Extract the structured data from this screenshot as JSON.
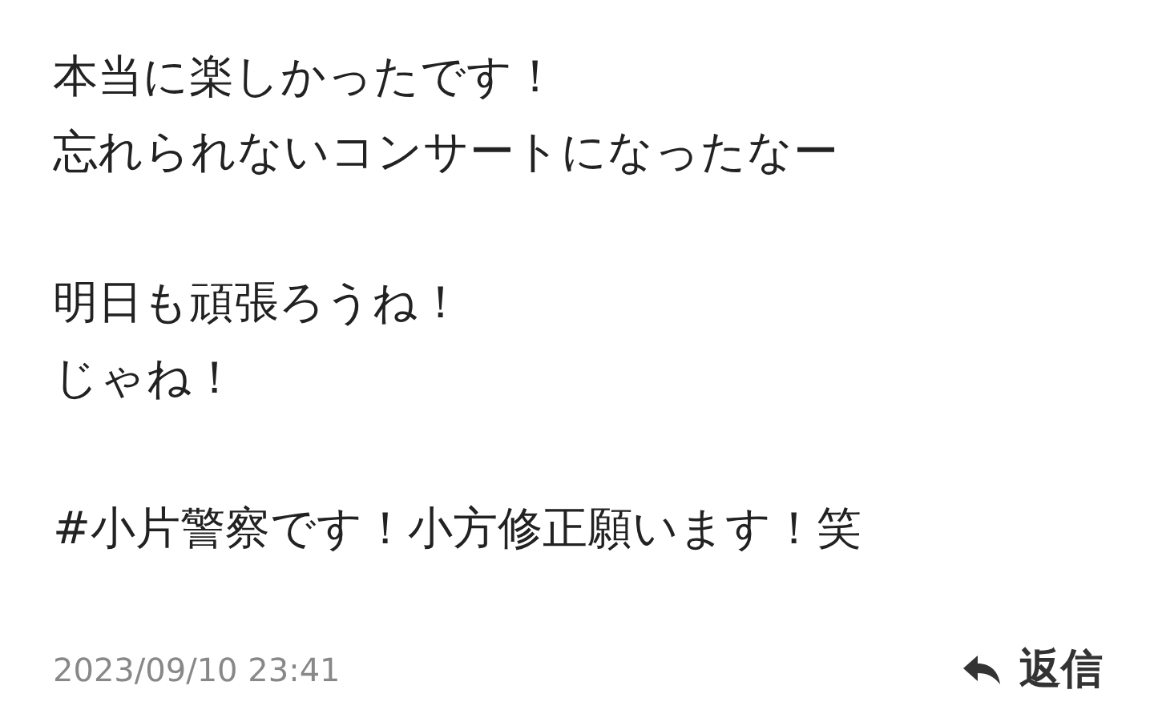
{
  "message": {
    "paragraphs": [
      {
        "lines": [
          "本当に楽しかったです！",
          "忘れられないコンサートになったなー"
        ]
      },
      {
        "lines": [
          "明日も頑張ろうね！",
          "じゃね！"
        ]
      },
      {
        "lines": [
          "#小片警察です！小方修正願います！笑"
        ]
      }
    ]
  },
  "footer": {
    "timestamp": "2023/09/10 23:41",
    "reply_button": "返信"
  }
}
